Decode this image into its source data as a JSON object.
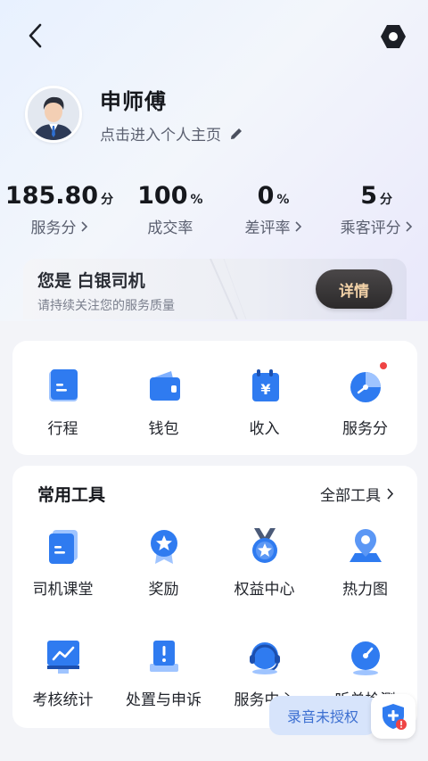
{
  "nav": {
    "back_icon": "back-arrow-icon",
    "settings_icon": "settings-hexagon-icon"
  },
  "profile": {
    "name": "申师傅",
    "link_label": "点击进入个人主页",
    "edit_icon": "pencil-icon"
  },
  "stats": [
    {
      "value": "185.80",
      "unit": "分",
      "label": "服务分",
      "has_chevron": true
    },
    {
      "value": "100",
      "unit": "%",
      "label": "成交率",
      "has_chevron": false
    },
    {
      "value": "0",
      "unit": "%",
      "label": "差评率",
      "has_chevron": true
    },
    {
      "value": "5",
      "unit": "分",
      "label": "乘客评分",
      "has_chevron": true
    }
  ],
  "tier": {
    "title": "您是 白银司机",
    "subtitle": "请持续关注您的服务质量",
    "button_label": "详情"
  },
  "main_actions": [
    {
      "label": "行程",
      "icon": "trip-book-icon"
    },
    {
      "label": "钱包",
      "icon": "wallet-icon"
    },
    {
      "label": "收入",
      "icon": "income-yen-icon"
    },
    {
      "label": "服务分",
      "icon": "service-score-gauge-icon",
      "badge_dot": true
    }
  ],
  "tools": {
    "title": "常用工具",
    "all_label": "全部工具",
    "items": [
      {
        "label": "司机课堂",
        "icon": "classroom-book-icon"
      },
      {
        "label": "奖励",
        "icon": "reward-medal-icon"
      },
      {
        "label": "权益中心",
        "icon": "benefits-medal-icon"
      },
      {
        "label": "热力图",
        "icon": "heatmap-pin-icon"
      },
      {
        "label": "考核统计",
        "icon": "assessment-chart-icon"
      },
      {
        "label": "处置与申诉",
        "icon": "appeal-exclamation-icon"
      },
      {
        "label": "服务中心",
        "icon": "service-headset-icon"
      },
      {
        "label": "听单检测",
        "icon": "order-check-gauge-icon"
      }
    ]
  },
  "floating": {
    "recording_label": "录音未授权",
    "shield_icon": "shield-alert-icon"
  },
  "colors": {
    "accent_blue": "#2f7bf0",
    "tier_gold": "#f2d2a8",
    "badge_red": "#ef4444"
  }
}
